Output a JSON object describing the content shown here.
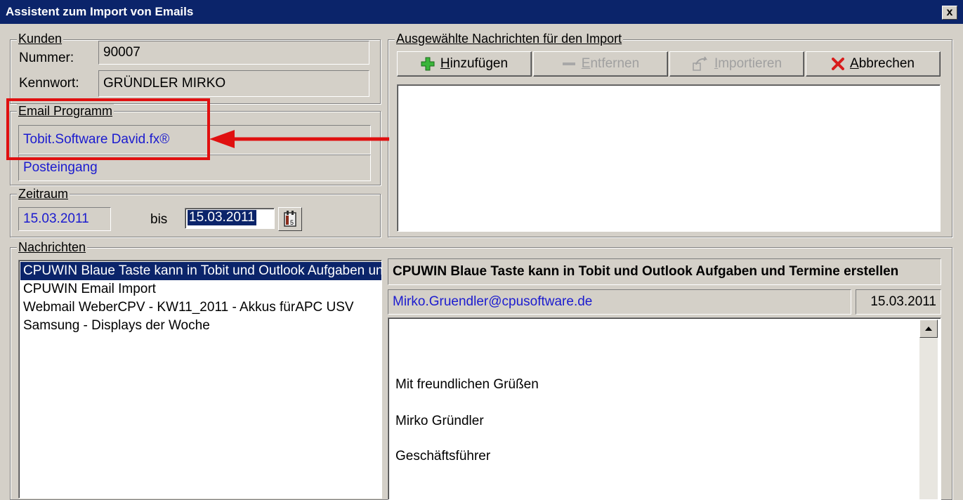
{
  "window": {
    "title": "Assistent zum Import von Emails",
    "close_label": "x"
  },
  "kunden": {
    "legend": "Kunden",
    "nummer_label": "Nummer:",
    "nummer_value": "90007",
    "kennwort_label": "Kennwort:",
    "kennwort_value": "GRÜNDLER MIRKO"
  },
  "email_programm": {
    "legend": "Email Programm",
    "program": "Tobit.Software David.fx®",
    "folder": "Posteingang"
  },
  "zeitraum": {
    "legend": "Zeitraum",
    "from": "15.03.2011",
    "bis_label": "bis",
    "to": "15.03.2011"
  },
  "import": {
    "legend": "Ausgewählte Nachrichten für den Import",
    "buttons": {
      "add": {
        "accel": "H",
        "rest": "inzufügen"
      },
      "remove": {
        "accel": "E",
        "rest": "ntfernen"
      },
      "import": {
        "accel": "I",
        "rest": "mportieren"
      },
      "cancel": {
        "accel": "A",
        "rest": "bbrechen"
      }
    }
  },
  "nachrichten": {
    "legend": "Nachrichten",
    "items": [
      "CPUWIN Blaue Taste kann in Tobit und Outlook Aufgaben und Termine erstellen",
      "CPUWIN Email Import",
      "Webmail WeberCPV - KW11_2011 - Akkus fürAPC USV",
      "Samsung - Displays der Woche"
    ]
  },
  "preview": {
    "subject": "CPUWIN Blaue Taste kann in Tobit und Outlook Aufgaben und Termine erstellen",
    "sender": "Mirko.Gruendler@cpusoftware.de",
    "date": "15.03.2011",
    "body": [
      "Mit freundlichen Grüßen",
      "Mirko Gründler",
      "Geschäftsführer"
    ]
  },
  "colors": {
    "titlebar": "#0b246a",
    "highlight": "#e01010",
    "link_blue": "#1b1bcf",
    "face": "#d4d0c8"
  },
  "icons": [
    "plus-icon",
    "minus-icon",
    "import-icon",
    "x-icon",
    "calendar-icon",
    "scroll-up-arrow-icon"
  ]
}
